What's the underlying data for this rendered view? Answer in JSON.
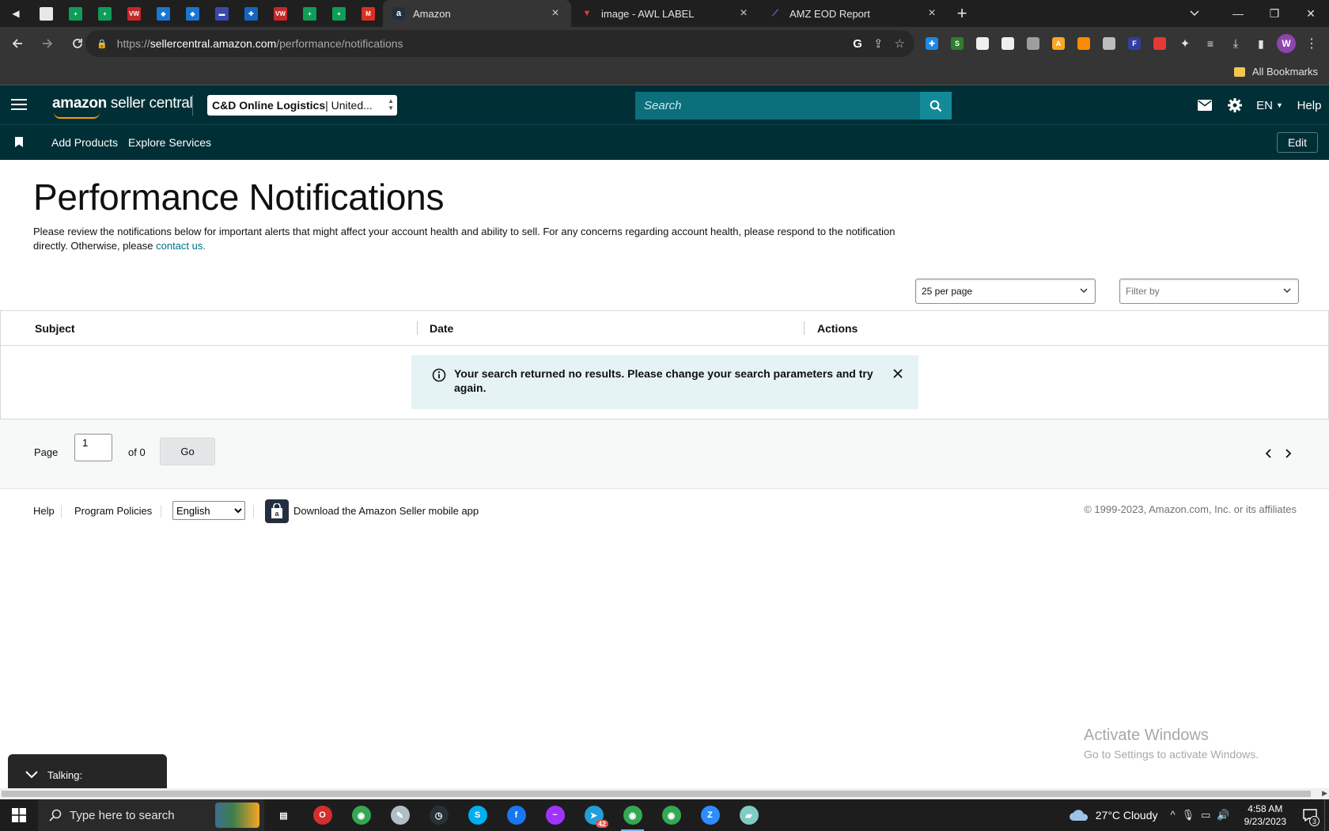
{
  "browser": {
    "pinned_tabs": [
      {
        "icon": "sheets-icon",
        "color": "#e8e8e8",
        "glyph": ""
      },
      {
        "icon": "sheets-plus-icon",
        "color": "#0f9d58",
        "glyph": "+"
      },
      {
        "icon": "sheets-plus-icon",
        "color": "#0f9d58",
        "glyph": "+"
      },
      {
        "icon": "vw-icon",
        "color": "#c62828",
        "glyph": "VW"
      },
      {
        "icon": "diamond-icon",
        "color": "#1976d2",
        "glyph": "◆"
      },
      {
        "icon": "diamond-icon",
        "color": "#1976d2",
        "glyph": "◆"
      },
      {
        "icon": "card-icon",
        "color": "#3949ab",
        "glyph": "▬"
      },
      {
        "icon": "medical-icon",
        "color": "#1565c0",
        "glyph": "✚"
      },
      {
        "icon": "vw-icon",
        "color": "#c62828",
        "glyph": "VW"
      },
      {
        "icon": "sheets-plus-icon",
        "color": "#0f9d58",
        "glyph": "+"
      },
      {
        "icon": "sheets-plus-icon",
        "color": "#0f9d58",
        "glyph": "+"
      },
      {
        "icon": "gmail-icon",
        "color": "#d93025",
        "glyph": "M"
      }
    ],
    "tabs": [
      {
        "title": "Amazon",
        "icon": "amazon-icon",
        "active": true
      },
      {
        "title": "image - AWL LABEL",
        "icon": "awl-icon",
        "active": false
      },
      {
        "title": "AMZ EOD Report",
        "icon": "clickup-icon",
        "active": false
      }
    ],
    "url_scheme": "https://",
    "url_host": "sellercentral.amazon.com",
    "url_path": "/performance/notifications",
    "profile_initial": "W",
    "bookmarks_label": "All Bookmarks",
    "extensions": [
      {
        "name": "ext-blue-icon",
        "color": "#1e88e5",
        "glyph": "✚"
      },
      {
        "name": "ext-s-icon",
        "color": "#2e7d32",
        "glyph": "S"
      },
      {
        "name": "ext-doc-icon",
        "color": "#eeeeee",
        "glyph": ""
      },
      {
        "name": "ext-signature-icon",
        "color": "#eeeeee",
        "glyph": ""
      },
      {
        "name": "ext-off-icon",
        "color": "#9e9e9e",
        "glyph": ""
      },
      {
        "name": "ext-a-icon",
        "color": "#f9a825",
        "glyph": "A"
      },
      {
        "name": "ext-orange-icon",
        "color": "#fb8c00",
        "glyph": ""
      },
      {
        "name": "ext-qr-icon",
        "color": "#bdbdbd",
        "glyph": ""
      },
      {
        "name": "ext-f-icon",
        "color": "#303f9f",
        "glyph": "F"
      },
      {
        "name": "ext-pokeball-icon",
        "color": "#e53935",
        "glyph": ""
      }
    ]
  },
  "header": {
    "logo_word": "amazon",
    "logo_rest": " seller central",
    "account_name": "C&D Online Logistics",
    "account_region": " | United...",
    "search_placeholder": "Search",
    "language": "EN",
    "help": "Help"
  },
  "subnav": {
    "links": [
      "Add Products",
      "Explore Services"
    ],
    "edit": "Edit"
  },
  "main": {
    "title": "Performance Notifications",
    "description": "Please review the notifications below for important alerts that might affect your account health and ability to sell. For any concerns regarding account health, please respond to the notification directly. Otherwise, please ",
    "contact_link": "contact us.",
    "per_page": "25 per page",
    "filter_placeholder": "Filter by",
    "columns": [
      "Subject",
      "Date",
      "Actions"
    ],
    "alert_text": "Your search returned no results. Please change your search parameters and try again."
  },
  "pager": {
    "page_label": "Page",
    "page_value": "1",
    "of_label": "of 0",
    "go": "Go"
  },
  "footer": {
    "help": "Help",
    "policies": "Program Policies",
    "language": "English",
    "app_link": "Download the Amazon Seller mobile app",
    "copyright": "© 1999-2023, Amazon.com, Inc. or its affiliates"
  },
  "overlay": {
    "activate_title": "Activate Windows",
    "activate_sub": "Go to Settings to activate Windows.",
    "talking": "Talking:"
  },
  "taskbar": {
    "search_placeholder": "Type here to search",
    "weather": "27°C  Cloudy",
    "time": "4:58 AM",
    "date": "9/23/2023",
    "notification_count": "3",
    "apps": [
      {
        "name": "task-view-icon",
        "color": "#1d1d1d",
        "glyph": "▤"
      },
      {
        "name": "opera-icon",
        "color": "#d32f2f",
        "glyph": "O"
      },
      {
        "name": "chrome-icon",
        "color": "#34a853",
        "glyph": "◉"
      },
      {
        "name": "paint-icon",
        "color": "#b0bec5",
        "glyph": "✎"
      },
      {
        "name": "clock-app-icon",
        "color": "#263238",
        "glyph": "◷"
      },
      {
        "name": "skype-icon",
        "color": "#00aff0",
        "glyph": "S"
      },
      {
        "name": "facebook-icon",
        "color": "#1877f2",
        "glyph": "f"
      },
      {
        "name": "messenger-icon",
        "color": "#a033ff",
        "glyph": "~"
      },
      {
        "name": "telegram-icon",
        "color": "#229ed9",
        "glyph": "➤",
        "badge": "42"
      },
      {
        "name": "chrome-w-icon",
        "color": "#34a853",
        "glyph": "◉",
        "active": true
      },
      {
        "name": "chrome-va-icon",
        "color": "#34a853",
        "glyph": "◉"
      },
      {
        "name": "zoom-icon",
        "color": "#2d8cff",
        "glyph": "Z"
      },
      {
        "name": "notes-icon",
        "color": "#80cbc4",
        "glyph": "▰"
      }
    ]
  }
}
